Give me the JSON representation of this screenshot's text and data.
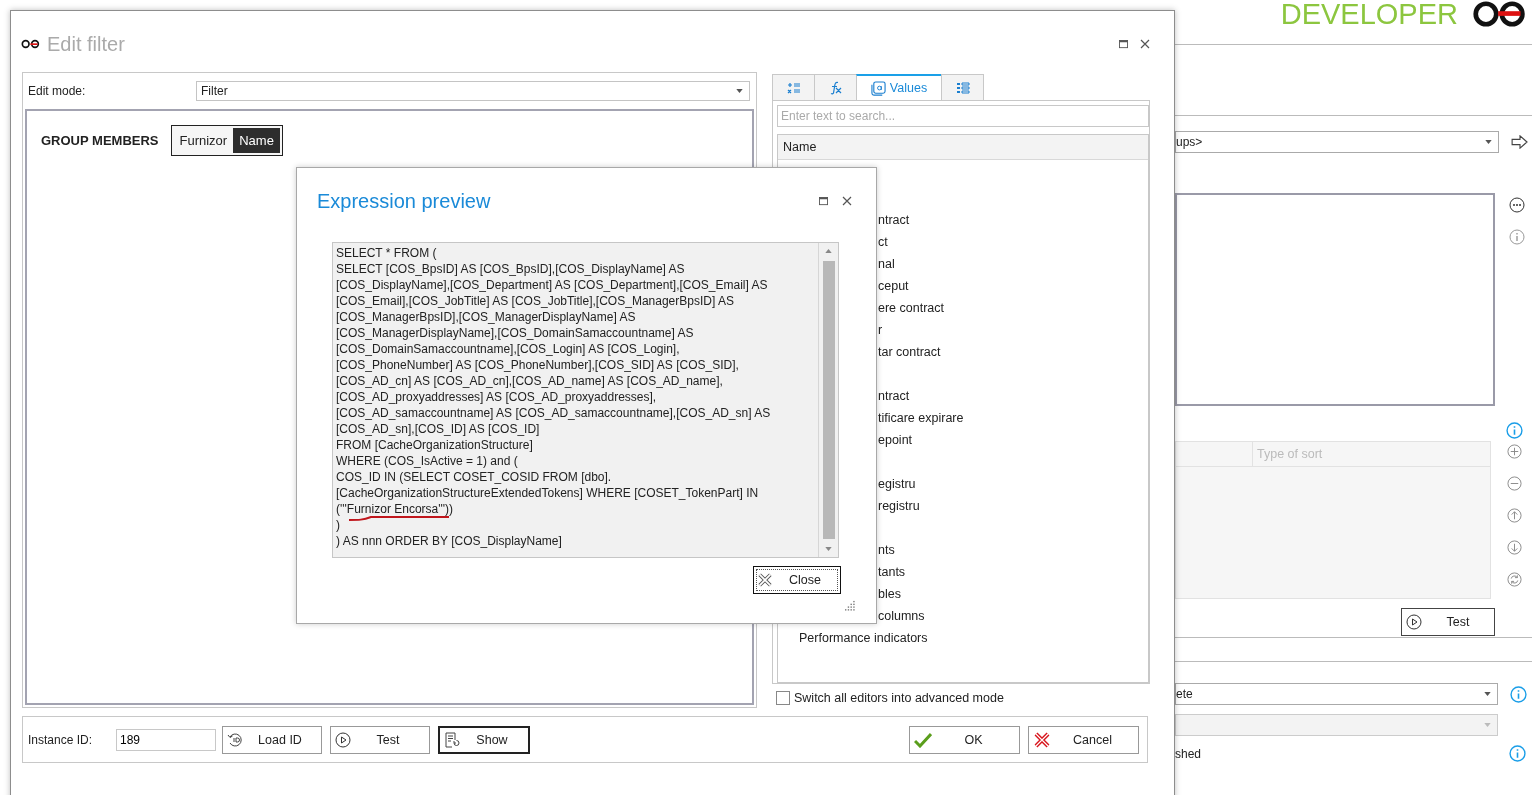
{
  "background_app": {
    "brand": "DEVELOPER",
    "dropdown_1": {
      "value": "ups>"
    },
    "table": {
      "columns": [
        "Type of sort"
      ]
    },
    "test_button": "Test",
    "dropdown_2": {
      "value": "ete"
    },
    "dropdown_3": {
      "disabled": true
    },
    "label": "shed"
  },
  "edit_filter": {
    "title": "Edit filter",
    "edit_mode": {
      "label": "Edit mode:",
      "value": "Filter"
    },
    "group_members": {
      "label": "GROUP MEMBERS",
      "tokens": [
        {
          "text": "Furnizor",
          "kind": "text"
        },
        {
          "text": "Name",
          "kind": "field"
        }
      ]
    },
    "tabs": [
      {
        "kind": "operators",
        "selected": false
      },
      {
        "kind": "functions",
        "selected": false
      },
      {
        "kind": "values",
        "label": "Values",
        "selected": true
      },
      {
        "kind": "list",
        "selected": false
      }
    ],
    "search": {
      "placeholder": "Enter text to search..."
    },
    "list": {
      "columns": [
        "Name"
      ],
      "items": [
        {
          "text": "ntract",
          "clipped": true,
          "gap_before": false
        },
        {
          "text": "ct",
          "clipped": true,
          "gap_before": false
        },
        {
          "text": "nal",
          "clipped": true,
          "gap_before": false
        },
        {
          "text": "ceput",
          "clipped": true,
          "gap_before": false
        },
        {
          "text": "ere contract",
          "clipped": true,
          "gap_before": false
        },
        {
          "text": "r",
          "clipped": true,
          "gap_before": false
        },
        {
          "text": "tar contract",
          "clipped": true,
          "gap_before": false
        },
        {
          "text": "ntract",
          "clipped": true,
          "gap_before": true
        },
        {
          "text": "tificare expirare",
          "clipped": true,
          "gap_before": false
        },
        {
          "text": "epoint",
          "clipped": true,
          "gap_before": false
        },
        {
          "text": "egistru",
          "clipped": true,
          "gap_before": true
        },
        {
          "text": "registru",
          "clipped": true,
          "gap_before": false
        },
        {
          "text": "nts",
          "clipped": true,
          "gap_before": true
        },
        {
          "text": "tants",
          "clipped": true,
          "gap_before": false
        },
        {
          "text": "bles",
          "clipped": true,
          "gap_before": false
        },
        {
          "text": "columns",
          "clipped": true,
          "gap_before": false
        },
        {
          "text": "Performance indicators",
          "clipped": false,
          "gap_before": false
        }
      ]
    },
    "advanced_mode": {
      "label": "Switch all editors into advanced mode",
      "checked": false
    },
    "instance_id": {
      "label": "Instance ID:",
      "value": "189"
    },
    "buttons": [
      {
        "label": "Load ID",
        "kind": "load",
        "focused": false
      },
      {
        "label": "Test",
        "kind": "test",
        "focused": false
      },
      {
        "label": "Show",
        "kind": "show",
        "focused": true
      },
      {
        "label": "OK",
        "kind": "ok",
        "focused": false
      },
      {
        "label": "Cancel",
        "kind": "cancel",
        "focused": false
      }
    ]
  },
  "expression_preview": {
    "title": "Expression preview",
    "code_lines": [
      "SELECT  * FROM (",
      "SELECT [COS_BpsID] AS [COS_BpsID],[COS_DisplayName] AS",
      "[COS_DisplayName],[COS_Department] AS [COS_Department],[COS_Email] AS",
      "[COS_Email],[COS_JobTitle] AS [COS_JobTitle],[COS_ManagerBpsID] AS",
      "[COS_ManagerBpsID],[COS_ManagerDisplayName] AS",
      "[COS_ManagerDisplayName],[COS_DomainSamaccountname] AS",
      "[COS_DomainSamaccountname],[COS_Login] AS [COS_Login],",
      "[COS_PhoneNumber] AS [COS_PhoneNumber],[COS_SID] AS [COS_SID],",
      "[COS_AD_cn] AS [COS_AD_cn],[COS_AD_name] AS [COS_AD_name],",
      "[COS_AD_proxyaddresses] AS [COS_AD_proxyaddresses],",
      "[COS_AD_samaccountname] AS [COS_AD_samaccountname],[COS_AD_sn] AS",
      "[COS_AD_sn],[COS_ID] AS [COS_ID]",
      "FROM [CacheOrganizationStructure]",
      "WHERE  (COS_IsActive = 1)  and  (",
      "COS_ID IN (SELECT COSET_COSID FROM [dbo].",
      "[CacheOrganizationStructureExtendedTokens] WHERE [COSET_TokenPart] IN",
      "('''Furnizor Encorsa'''))",
      ")",
      ") AS nnn ORDER BY [COS_DisplayName]"
    ],
    "close_button": "Close"
  }
}
